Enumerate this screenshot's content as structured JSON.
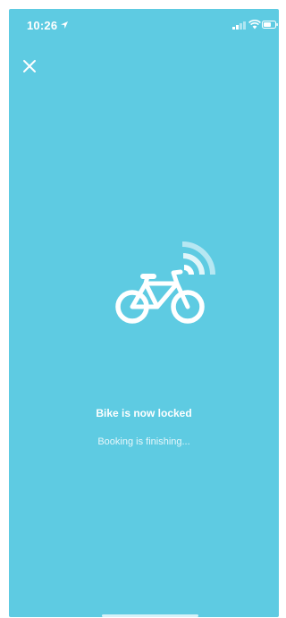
{
  "status_bar": {
    "time": "10:26",
    "icons": [
      "location-arrow-icon",
      "cellular-signal-icon",
      "wifi-icon",
      "battery-icon"
    ]
  },
  "header": {
    "close_icon": "close-icon"
  },
  "illustration": {
    "icon": "bike-wireless-icon"
  },
  "status": {
    "title": "Bike is now locked",
    "subtitle": "Booking is finishing..."
  },
  "colors": {
    "background": "#5ecbe2",
    "foreground": "#ffffff"
  }
}
